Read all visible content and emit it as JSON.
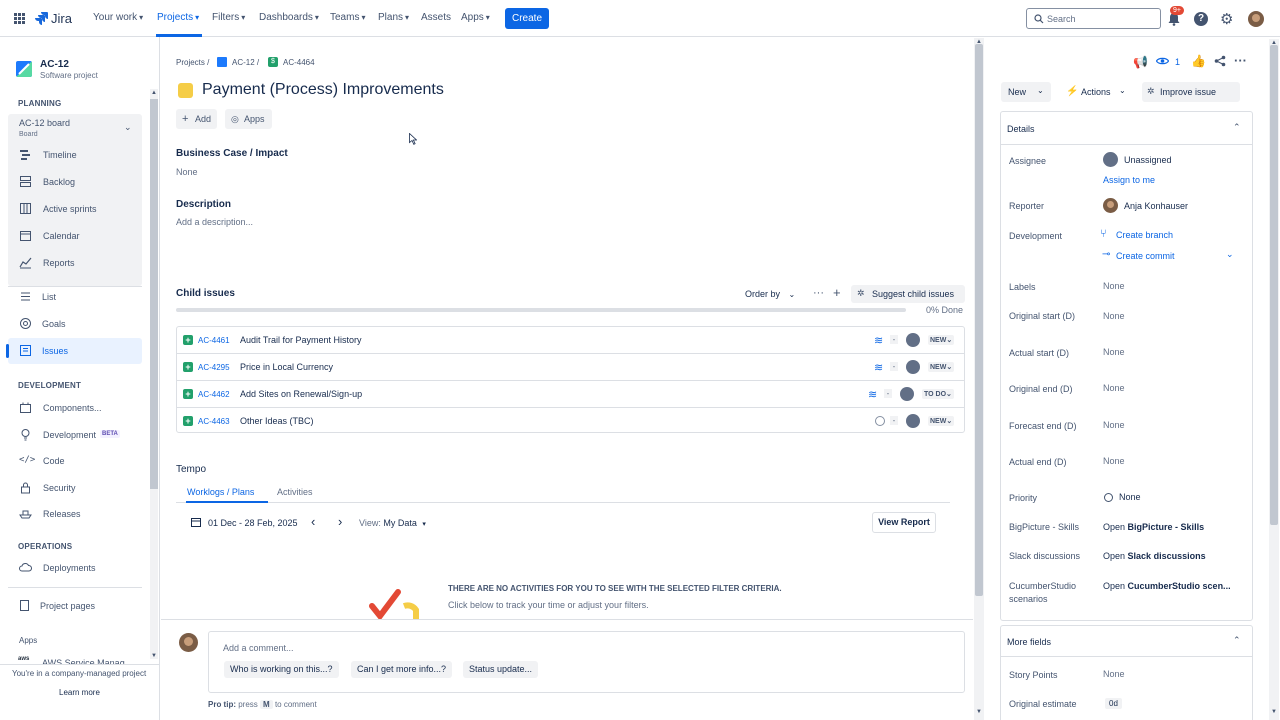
{
  "topnav": {
    "app_name": "Jira",
    "items": [
      {
        "label": "Your work"
      },
      {
        "label": "Projects"
      },
      {
        "label": "Filters"
      },
      {
        "label": "Dashboards"
      },
      {
        "label": "Teams"
      },
      {
        "label": "Plans"
      },
      {
        "label": "Assets"
      },
      {
        "label": "Apps"
      }
    ],
    "create_label": "Create",
    "search_placeholder": "Search",
    "notif_count": "9+",
    "accent": "#0c66e4"
  },
  "sidebar": {
    "project_name": "AC-12",
    "project_type": "Software project",
    "planning_heading": "PLANNING",
    "board_name": "AC-12 board",
    "board_sub": "Board",
    "planning_items": [
      "Timeline",
      "Backlog",
      "Active sprints",
      "Calendar",
      "Reports"
    ],
    "list_items": [
      "List",
      "Goals",
      "Issues"
    ],
    "development_heading": "DEVELOPMENT",
    "dev_items": [
      "Components...",
      "Development",
      "Code",
      "Security",
      "Releases"
    ],
    "dev_beta": "BETA",
    "operations_heading": "OPERATIONS",
    "ops_items": [
      "Deployments"
    ],
    "project_pages": "Project pages",
    "apps_heading": "Apps",
    "apps_item": "AWS Service Manag...",
    "footer_text": "You're in a company-managed project",
    "learn_more": "Learn more"
  },
  "breadcrumb": {
    "items": [
      "Projects",
      "AC-12",
      "AC-4464"
    ]
  },
  "issue": {
    "title": "Payment (Process) Improvements",
    "add_label": "Add",
    "apps_label": "Apps",
    "business_case_label": "Business Case / Impact",
    "business_case_value": "None",
    "description_label": "Description",
    "description_placeholder": "Add a description..."
  },
  "child_issues": {
    "heading": "Child issues",
    "order_by": "Order by",
    "suggest": "Suggest child issues",
    "progress_text": "0% Done",
    "progress_done": 0,
    "rows": [
      {
        "key": "AC-4461",
        "summary": "Audit Trail for Payment History",
        "status": "NEW",
        "priority": "lowest-icon"
      },
      {
        "key": "AC-4295",
        "summary": "Price in Local Currency",
        "status": "NEW",
        "priority": "lowest-icon"
      },
      {
        "key": "AC-4462",
        "summary": "Add Sites on Renewal/Sign-up",
        "status": "TO DO",
        "priority": "lowest-icon"
      },
      {
        "key": "AC-4463",
        "summary": "Other Ideas (TBC)",
        "status": "NEW",
        "priority": "none-icon"
      }
    ]
  },
  "tempo": {
    "heading": "Tempo",
    "tabs": [
      "Worklogs / Plans",
      "Activities"
    ],
    "date_range": "01 Dec - 28 Feb, 2025",
    "view_label": "View:",
    "view_value": "My Data",
    "view_report": "View Report",
    "empty_title": "THERE ARE NO ACTIVITIES FOR YOU TO SEE WITH THE SELECTED FILTER CRITERIA.",
    "empty_sub": "Click below to track your time or adjust your filters."
  },
  "comment": {
    "placeholder": "Add a comment...",
    "chips": [
      "Who is working on this...?",
      "Can I get more info...?",
      "Status update..."
    ],
    "pro_tip_prefix": "Pro tip:",
    "pro_tip_press": "press",
    "pro_tip_key": "M",
    "pro_tip_suffix": "to comment"
  },
  "right_panel": {
    "watch_count": "1",
    "status_label": "New",
    "actions_label": "Actions",
    "improve_label": "Improve issue",
    "details_heading": "Details",
    "assignee_label": "Assignee",
    "assignee_value": "Unassigned",
    "assign_to_me": "Assign to me",
    "reporter_label": "Reporter",
    "reporter_value": "Anja Konhauser",
    "development_label": "Development",
    "create_branch": "Create branch",
    "create_commit": "Create commit",
    "labels_label": "Labels",
    "labels_value": "None",
    "original_start_label": "Original start (D)",
    "original_start_value": "None",
    "actual_start_label": "Actual start (D)",
    "actual_start_value": "None",
    "original_end_label": "Original end (D)",
    "original_end_value": "None",
    "forecast_end_label": "Forecast end (D)",
    "forecast_end_value": "None",
    "actual_end_label": "Actual end (D)",
    "actual_end_value": "None",
    "priority_label": "Priority",
    "priority_value": "None",
    "bigpicture_label": "BigPicture - Skills",
    "bigpicture_open": "Open",
    "bigpicture_value": "BigPicture - Skills",
    "slack_label": "Slack discussions",
    "slack_open": "Open",
    "slack_value": "Slack discussions",
    "cucumber_label_1": "CucumberStudio",
    "cucumber_label_2": "scenarios",
    "cucumber_open": "Open",
    "cucumber_value": "CucumberStudio scen...",
    "more_fields_heading": "More fields",
    "story_points_label": "Story Points",
    "story_points_value": "None",
    "original_estimate_label": "Original estimate",
    "original_estimate_value": "0d"
  }
}
